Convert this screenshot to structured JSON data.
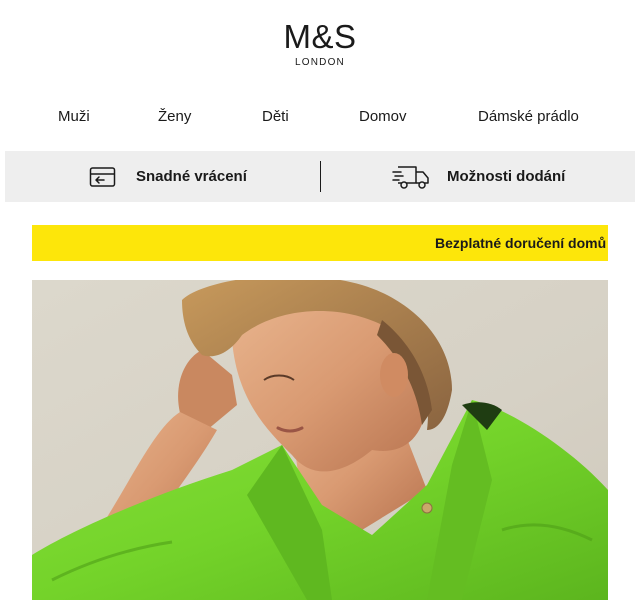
{
  "brand": {
    "name": "M&S",
    "subtitle": "LONDON"
  },
  "nav": {
    "items": [
      {
        "label": "Muži"
      },
      {
        "label": "Ženy"
      },
      {
        "label": "Děti"
      },
      {
        "label": "Domov"
      },
      {
        "label": "Dámské prádlo"
      }
    ]
  },
  "services": {
    "returns": {
      "label": "Snadné vrácení",
      "icon": "return-box-icon"
    },
    "delivery": {
      "label": "Možnosti dodání",
      "icon": "delivery-truck-icon"
    }
  },
  "promo": {
    "text": "Bezplatné doručení domů",
    "background": "#fde60a"
  },
  "hero": {
    "subject": "woman-in-green-shirt-photo"
  },
  "colors": {
    "text": "#1a1a1a",
    "service_bar": "#eeeeee",
    "promo_bar": "#fde60a",
    "shirt_green": "#74d32a"
  }
}
